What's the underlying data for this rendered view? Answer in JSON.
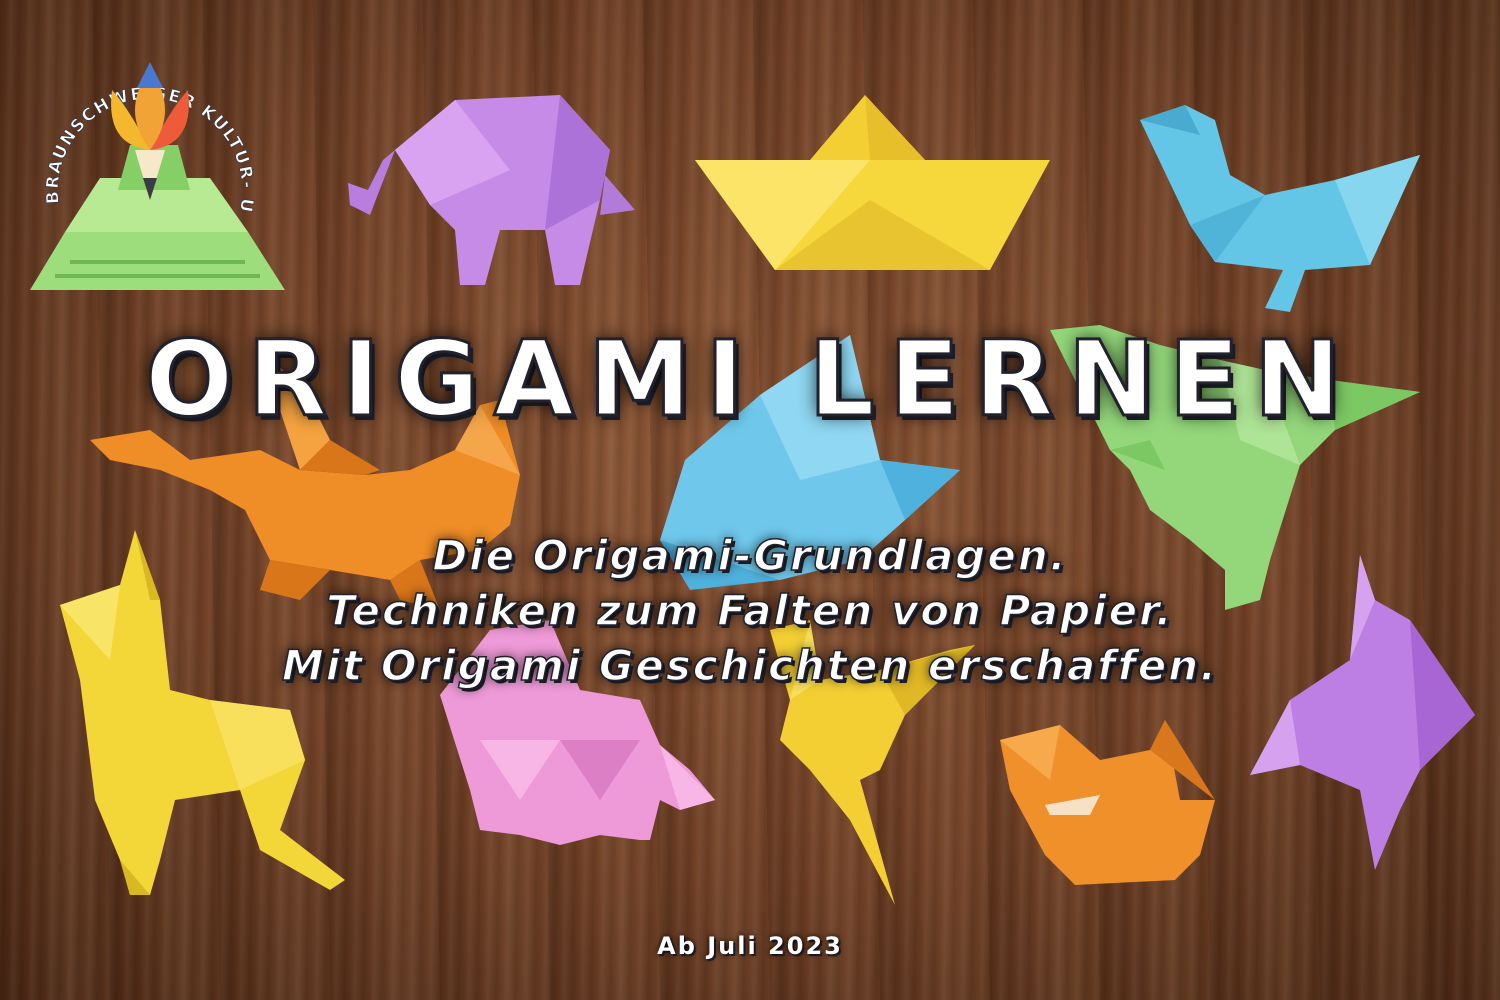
{
  "logo": {
    "text": "BRAUNSCHWEIGER KULTUR- UND BILDUNGSHAUS e.V."
  },
  "title": "ORIGAMI LERNEN",
  "subtitle_lines": [
    "Die Origami-Grundlagen.",
    "Techniken zum Falten von Papier.",
    "Mit Origami Geschichten erschaffen."
  ],
  "date": "Ab Juli 2023",
  "origami": [
    {
      "name": "elephant",
      "color": "#c58be6"
    },
    {
      "name": "paper-boat",
      "color": "#f5d63a"
    },
    {
      "name": "goose",
      "color": "#63c6e6"
    },
    {
      "name": "dragon",
      "color": "#ef8d26"
    },
    {
      "name": "crane",
      "color": "#6fc8ec"
    },
    {
      "name": "dinosaur",
      "color": "#93d77a"
    },
    {
      "name": "llama",
      "color": "#f3d638"
    },
    {
      "name": "pig",
      "color": "#ef9ad8"
    },
    {
      "name": "bird",
      "color": "#f3cf34"
    },
    {
      "name": "cat",
      "color": "#f0902a"
    },
    {
      "name": "fish",
      "color": "#bd7fe3"
    }
  ],
  "colors": {
    "wood": "#6e3f24",
    "text_fill": "#ffffff",
    "text_outline": "#22222e"
  }
}
